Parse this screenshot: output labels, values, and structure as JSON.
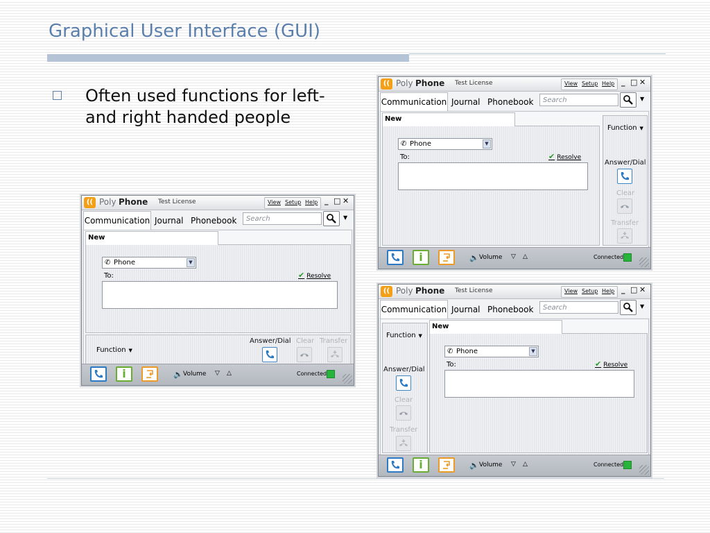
{
  "slide": {
    "title": "Graphical User Interface (GUI)",
    "bullet": "Often used functions for left-and right handed people"
  },
  "app": {
    "brand_poly": "Poly",
    "brand_phone": "Phone",
    "license": "Test License",
    "menu": {
      "view": "View",
      "setup": "Setup",
      "help": "Help"
    },
    "window_controls": {
      "minimize": "_",
      "maximize": "□",
      "close": "✕"
    },
    "logo": "((",
    "nav": {
      "communication": "Communication",
      "journal": "Journal",
      "phonebook": "Phonebook"
    },
    "search_placeholder": "Search",
    "caret": "▼",
    "new_tab": "New",
    "phone_select": "Phone",
    "to_label": "To:",
    "resolve": "Resolve",
    "function_label": "Function",
    "answer_dial": "Answer/Dial",
    "clear": "Clear",
    "transfer": "Transfer",
    "volume": "Volume",
    "volume_down": "▽",
    "volume_up": "△",
    "connected": "Connected",
    "info_glyph": "i",
    "check_glyph": "✔",
    "speaker_glyph": "🔈",
    "icons": {
      "search": "search-icon",
      "phone": "phone-icon",
      "info": "info-icon",
      "transfer": "transfer-icon",
      "volume": "volume-icon"
    },
    "colors": {
      "accent_blue": "#2c79c4",
      "info_green": "#69ad32",
      "transfer_orange": "#ec9a28",
      "connected_green": "#27b43a",
      "title_blue": "#5a7fad"
    }
  }
}
